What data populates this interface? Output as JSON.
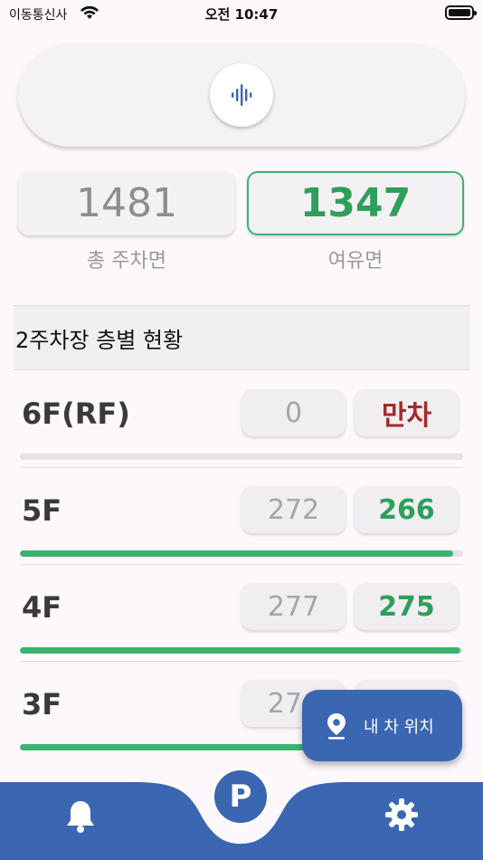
{
  "status_bar": {
    "carrier": "이동통신사",
    "time": "오전 10:47"
  },
  "voice": {
    "icon": "voice-waveform-icon"
  },
  "summary": {
    "total_value": "1481",
    "total_label": "총 주차면",
    "free_value": "1347",
    "free_label": "여유면"
  },
  "section": {
    "title": "2주차장 층별 현황"
  },
  "floors": [
    {
      "label": "6F(RF)",
      "capacity": "0",
      "free": "만차",
      "fill": 0,
      "full": true
    },
    {
      "label": "5F",
      "capacity": "272",
      "free": "266",
      "fill": 0.978
    },
    {
      "label": "4F",
      "capacity": "277",
      "free": "275",
      "fill": 0.993
    },
    {
      "label": "3F",
      "capacity": "276",
      "free": "",
      "fill": 0.98
    }
  ],
  "fab": {
    "label": "내 차 위치",
    "icon": "location-pin-icon"
  },
  "nav": {
    "center_label": "P",
    "left_icon": "bell-icon",
    "right_icon": "gear-icon"
  },
  "colors": {
    "accent_blue": "#3a66b2",
    "available_green": "#2e9f5a",
    "full_red": "#a52a2a"
  }
}
